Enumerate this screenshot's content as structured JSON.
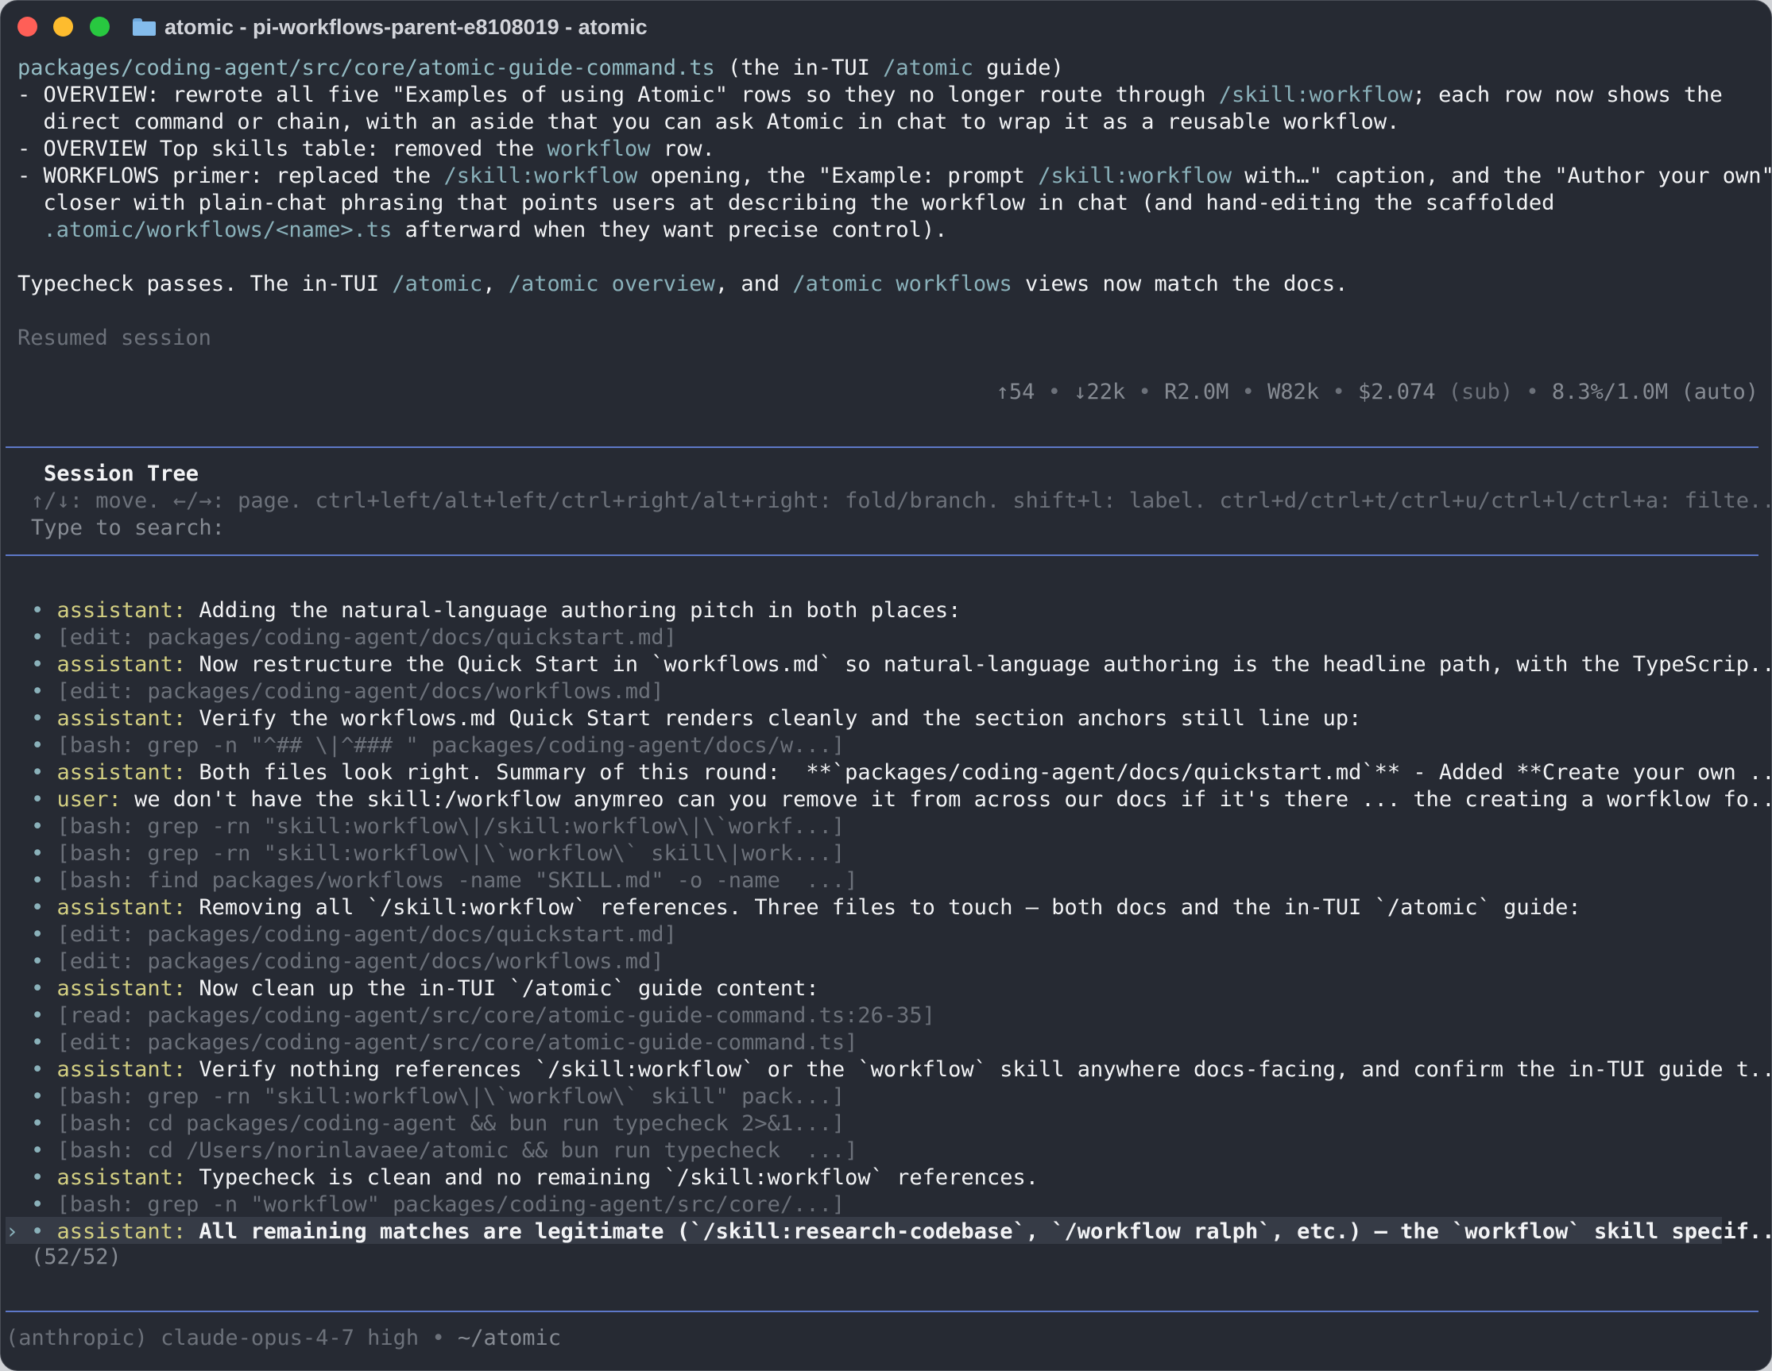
{
  "window": {
    "title": "atomic - pi-workflows-parent-e8108019 - atomic"
  },
  "summary": {
    "file_path": "packages/coding-agent/src/core/atomic-guide-command.ts",
    "file_note_pre": " (the in-TUI ",
    "file_note_code": "/atomic",
    "file_note_post": " guide)",
    "b1_a": "- OVERVIEW: rewrote all five \"Examples of using Atomic\" rows so they no longer route through ",
    "b1_code": "/skill:workflow",
    "b1_b": "; each row now shows the",
    "b1_c": "  direct command or chain, with an aside that you can ask Atomic in chat to wrap it as a reusable workflow.",
    "b2_a": "- OVERVIEW Top skills table: removed the ",
    "b2_code": "workflow",
    "b2_b": " row.",
    "b3_a": "- WORKFLOWS primer: replaced the ",
    "b3_code1": "/skill:workflow",
    "b3_b": " opening, the \"Example: prompt ",
    "b3_code2": "/skill:workflow",
    "b3_c": " with…\" caption, and the \"Author your own\"",
    "b3_d": "  closer with plain-chat phrasing that points users at describing the workflow in chat (and hand-editing the scaffolded",
    "b3_code3": "  .atomic/workflows/<name>.ts",
    "b3_e": " afterward when they want precise control).",
    "t_a": "Typecheck passes. The in-TUI ",
    "t_code1": "/atomic",
    "t_b": ", ",
    "t_code2": "/atomic overview",
    "t_c": ", and ",
    "t_code3": "/atomic workflows",
    "t_d": " views now match the docs.",
    "resumed": "Resumed session"
  },
  "stats": {
    "up": "↑54",
    "down": "↓22k",
    "read": "R2.0M",
    "write": "W82k",
    "cost": "$2.074",
    "sub": "(sub)",
    "context": "8.3%/1.0M",
    "auto": "(auto)",
    "sep": "•"
  },
  "session_tree": {
    "title": "Session Tree",
    "help": "↑/↓: move. ←/→: page. ctrl+left/alt+left/ctrl+right/alt+right: fold/branch. shift+l: label. ctrl+d/ctrl+t/ctrl+u/ctrl+l/ctrl+a: filte...",
    "search_placeholder": "Type to search:",
    "bullet": "•",
    "cursor": "›",
    "entries": [
      {
        "role": "assistant:",
        "text": "Adding the natural-language authoring pitch in both places:"
      },
      {
        "text": "[edit: packages/coding-agent/docs/quickstart.md]"
      },
      {
        "role": "assistant:",
        "text": "Now restructure the Quick Start in `workflows.md` so natural-language authoring is the headline path, with the TypeScrip..."
      },
      {
        "text": "[edit: packages/coding-agent/docs/workflows.md]"
      },
      {
        "role": "assistant:",
        "text": "Verify the workflows.md Quick Start renders cleanly and the section anchors still line up:"
      },
      {
        "text": "[bash: grep -n \"^## \\|^### \" packages/coding-agent/docs/w...]"
      },
      {
        "role": "assistant:",
        "text": "Both files look right. Summary of this round:  **`packages/coding-agent/docs/quickstart.md`** - Added **Create your own ..."
      },
      {
        "role": "user:",
        "text": "we don't have the skill:/workflow anymreo can you remove it from across our docs if it's there ... the creating a worfklow fo..."
      },
      {
        "text": "[bash: grep -rn \"skill:workflow\\|/skill:workflow\\|\\`workf...]"
      },
      {
        "text": "[bash: grep -rn \"skill:workflow\\|\\`workflow\\` skill\\|work...]"
      },
      {
        "text": "[bash: find packages/workflows -name \"SKILL.md\" -o -name  ...]"
      },
      {
        "role": "assistant:",
        "text": "Removing all `/skill:workflow` references. Three files to touch — both docs and the in-TUI `/atomic` guide:"
      },
      {
        "text": "[edit: packages/coding-agent/docs/quickstart.md]"
      },
      {
        "text": "[edit: packages/coding-agent/docs/workflows.md]"
      },
      {
        "role": "assistant:",
        "text": "Now clean up the in-TUI `/atomic` guide content:"
      },
      {
        "text": "[read: packages/coding-agent/src/core/atomic-guide-command.ts:26-35]"
      },
      {
        "text": "[edit: packages/coding-agent/src/core/atomic-guide-command.ts]"
      },
      {
        "role": "assistant:",
        "text": "Verify nothing references `/skill:workflow` or the `workflow` skill anywhere docs-facing, and confirm the in-TUI guide t..."
      },
      {
        "text": "[bash: grep -rn \"skill:workflow\\|\\`workflow\\` skill\" pack...]"
      },
      {
        "text": "[bash: cd packages/coding-agent && bun run typecheck 2>&1...]"
      },
      {
        "text": "[bash: cd /Users/norinlavaee/atomic && bun run typecheck  ...]"
      },
      {
        "role": "assistant:",
        "text": "Typecheck is clean and no remaining `/skill:workflow` references."
      },
      {
        "text": "[bash: grep -n \"workflow\" packages/coding-agent/src/core/...]"
      },
      {
        "role": "assistant:",
        "text": "All remaining matches are legitimate (`/skill:research-codebase`, `/workflow ralph`, etc.) — the `workflow` skill specif..."
      }
    ],
    "counter": "(52/52)"
  },
  "footer": {
    "provider": "(anthropic)",
    "model": "claude-opus-4-7 high",
    "sep": "•",
    "cwd": "~/atomic"
  },
  "colors": {
    "background": "#262a33",
    "text": "#f2f3f5",
    "accent_code": "#8ab1ba",
    "role_label": "#d3cf82",
    "dim": "#6c717a",
    "rule": "#5d78c8"
  }
}
